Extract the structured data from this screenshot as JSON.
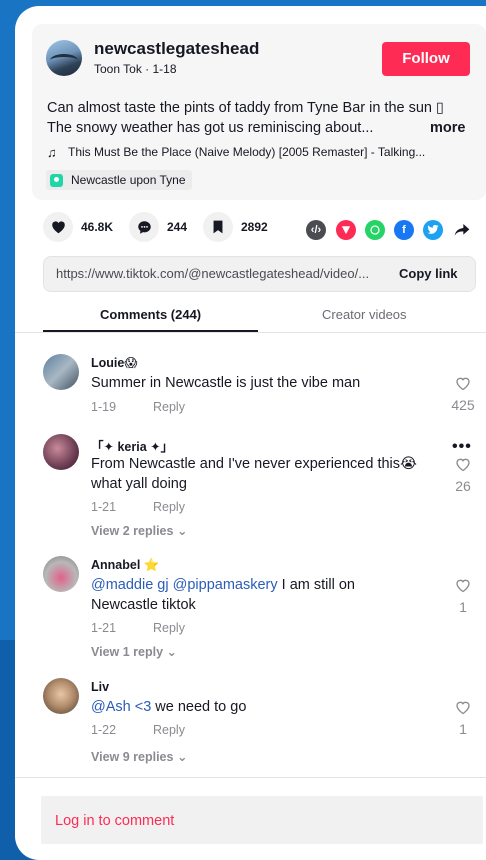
{
  "post": {
    "username": "newcastlegateshead",
    "subline": "Toon Tok · 1-18",
    "follow_label": "Follow",
    "description_line1": "Can almost taste the pints of taddy from Tyne Bar in the sun ▯",
    "description_line2": "The snowy weather has got us reminiscing about...",
    "more_label": "more",
    "music": "This Must Be the Place (Naive Melody) [2005 Remaster] - Talking...",
    "location": "Newcastle upon Tyne"
  },
  "stats": {
    "likes": "46.8K",
    "comments": "244",
    "saves": "2892"
  },
  "share": {
    "link": "https://www.tiktok.com/@newcastlegateshead/video/...",
    "copy_label": "Copy link"
  },
  "tabs": {
    "comments": "Comments (244)",
    "creator": "Creator videos"
  },
  "comments": [
    {
      "name": "Louie",
      "emoji": "😱",
      "text": "Summer in Newcastle is just the vibe man",
      "date": "1-19",
      "reply": "Reply",
      "likes": "425"
    },
    {
      "name": "「✦ keria ✦」",
      "text_line1": "From Newcastle and I've never experienced this😭",
      "text_line2": "what yall doing",
      "date": "1-21",
      "reply": "Reply",
      "likes": "26",
      "view_replies": "View 2 replies"
    },
    {
      "name": "Annabel",
      "emoji": "⭐",
      "mention": "@maddie gj @pippamaskery",
      "text_rest": " I am still on",
      "text_line2": "Newcastle tiktok",
      "date": "1-21",
      "reply": "Reply",
      "likes": "1",
      "view_replies": "View 1 reply"
    },
    {
      "name": "Liv",
      "mention": "@Ash <3",
      "text_rest": " we need to go",
      "date": "1-22",
      "reply": "Reply",
      "likes": "1",
      "view_replies": "View 9 replies"
    }
  ],
  "login_label": "Log in to comment",
  "colors": {
    "accent": "#fe2c55",
    "mention": "#2b5db8",
    "background": "#1a74c4"
  }
}
